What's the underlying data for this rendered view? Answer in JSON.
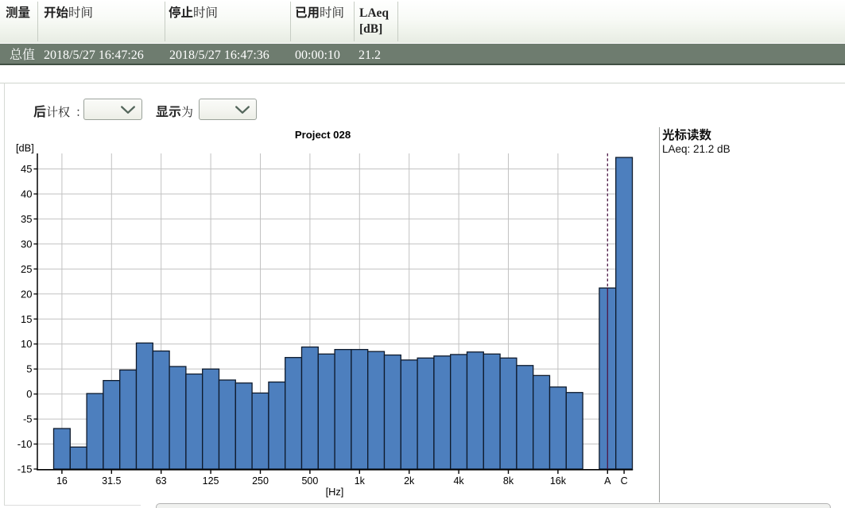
{
  "window": {
    "title": "Project 028 measurement view"
  },
  "table": {
    "header": [
      {
        "bold": "测量",
        "rest": ""
      },
      {
        "bold": "开始",
        "rest": "时间"
      },
      {
        "bold": "停止",
        "rest": "时间"
      },
      {
        "bold": "已用",
        "rest": "时间"
      },
      {
        "bold": "LAeq",
        "rest": "",
        "line2": "[dB]"
      }
    ],
    "row": {
      "name": "总值",
      "start_time": "2018/5/27 16:47:26",
      "stop_time": "2018/5/27 16:47:36",
      "elapsed_time": "00:00:10",
      "laeq": "21.2"
    }
  },
  "controls": {
    "post_weighting": {
      "label_bold": "后",
      "label_rest": "计权",
      "colon": "：",
      "value": ""
    },
    "display_as": {
      "label_bold": "显示",
      "label_rest": "为",
      "value": ""
    }
  },
  "cursor_panel": {
    "title": "光标读数",
    "reading": "LAeq: 21.2 dB"
  },
  "chart_data": {
    "type": "bar",
    "title": "Project 028",
    "ylabel": "[dB]",
    "xlabel": "[Hz]",
    "ylim": [
      -15,
      48.1
    ],
    "yticks": [
      -15,
      -10,
      -5,
      0,
      5,
      10,
      15,
      20,
      25,
      30,
      35,
      40,
      45
    ],
    "categories": [
      "16",
      "20",
      "25",
      "31.5",
      "40",
      "50",
      "63",
      "80",
      "100",
      "125",
      "160",
      "200",
      "250",
      "315",
      "400",
      "500",
      "630",
      "800",
      "1k",
      "1.25k",
      "1.6k",
      "2k",
      "2.5k",
      "3.15k",
      "4k",
      "5k",
      "6.3k",
      "8k",
      "10k",
      "12.5k",
      "16k",
      "20k"
    ],
    "values": [
      -6.9,
      -10.6,
      0.1,
      2.7,
      4.8,
      10.2,
      8.6,
      5.5,
      4.0,
      5.0,
      2.8,
      2.2,
      0.2,
      2.4,
      7.3,
      9.4,
      8.0,
      8.9,
      8.9,
      8.5,
      7.8,
      6.8,
      7.2,
      7.6,
      7.9,
      8.4,
      8.0,
      7.2,
      5.7,
      3.7,
      1.4,
      0.3
    ],
    "xtick_labels": [
      "16",
      "31.5",
      "63",
      "125",
      "250",
      "500",
      "1k",
      "2k",
      "4k",
      "8k",
      "16k"
    ],
    "labeled_every": 3,
    "extra_bars": [
      {
        "label": "A",
        "value": 21.2
      },
      {
        "label": "C",
        "value": 47.3
      }
    ],
    "cursor": {
      "bar": "A",
      "value": 21.2
    },
    "grid": true,
    "legend": null,
    "colors": {
      "bar_fill": "#4d7fbe",
      "bar_stroke": "#0e1a2c",
      "grid_line": "#c2c2c2",
      "axis_line": "#000000",
      "cursor_line": "#4c1745",
      "text": "#000000"
    }
  },
  "colors": {
    "header_row_bg_top": "#ffffff",
    "header_row_bg_bottom": "#e7ece3",
    "value_row_bg": "#6e7c6f",
    "value_row_border": "#414f43",
    "value_row_text": "#ffffff",
    "panel_line": "#d0d5cd"
  }
}
